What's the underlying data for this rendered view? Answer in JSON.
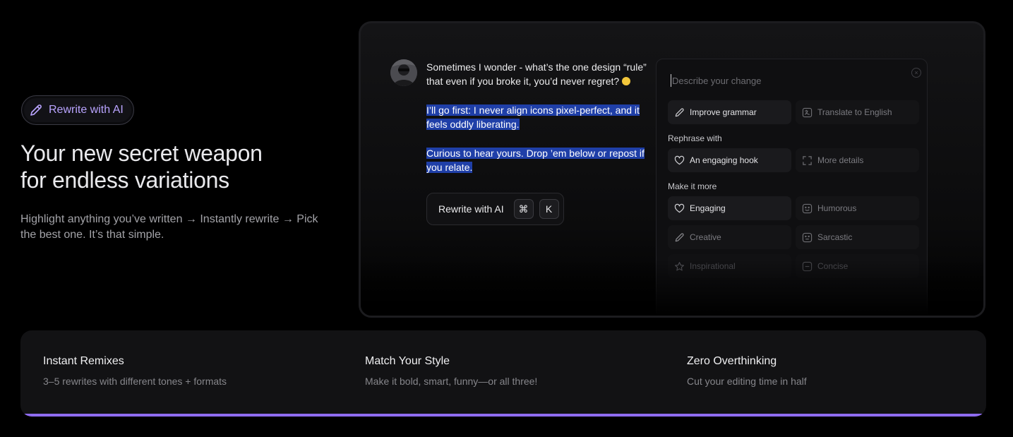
{
  "hero": {
    "badge_label": "Rewrite with AI",
    "title_line1": "Your new secret weapon",
    "title_line2": "for endless variations",
    "description": "Highlight anything you’ve written → Instantly rewrite → Pick the best one. It’s that simple."
  },
  "post": {
    "paragraph1": "Sometimes I wonder - what’s the one design “rule” that even if you broke it, you’d never regret?",
    "paragraph2": "I’ll go first: I never align icons pixel-perfect, and it feels oddly liberating.",
    "paragraph3": "Curious to hear yours. Drop ’em below or repost if you relate."
  },
  "rewrite_popup": {
    "label": "Rewrite with AI",
    "key1": "⌘",
    "key2": "K"
  },
  "panel": {
    "placeholder": "Describe your change",
    "close_glyph": "×",
    "top_options": [
      {
        "label": "Improve grammar",
        "icon": "pencil-icon"
      },
      {
        "label": "Translate to English",
        "icon": "translate-icon"
      }
    ],
    "rephrase_heading": "Rephrase with",
    "rephrase_options": [
      {
        "label": "An engaging hook",
        "icon": "heart-icon"
      },
      {
        "label": "More details",
        "icon": "expand-icon"
      }
    ],
    "more_heading": "Make it more",
    "more_options": [
      {
        "label": "Engaging",
        "icon": "heart-icon"
      },
      {
        "label": "Humorous",
        "icon": "smile-icon"
      },
      {
        "label": "Creative",
        "icon": "pencil-icon"
      },
      {
        "label": "Sarcastic",
        "icon": "smirk-icon"
      },
      {
        "label": "Inspirational",
        "icon": "star-icon"
      },
      {
        "label": "Concise",
        "icon": "minus-icon"
      }
    ]
  },
  "features": [
    {
      "title": "Instant Remixes",
      "description": "3–5 rewrites with different tones + formats"
    },
    {
      "title": "Match Your Style",
      "description": "Make it bold, smart, funny—or all three!"
    },
    {
      "title": "Zero Overthinking",
      "description": "Cut your editing time in half"
    }
  ],
  "colors": {
    "accent": "#8f6cf0",
    "badge_text": "#b9a4ff",
    "selection": "#1f3fa8",
    "background": "#000000"
  }
}
